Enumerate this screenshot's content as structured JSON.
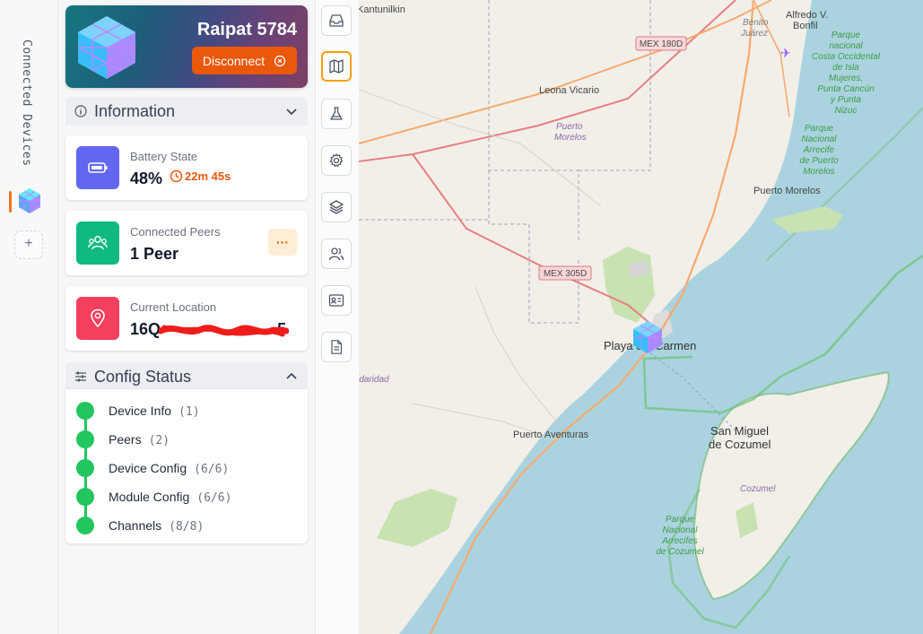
{
  "rail": {
    "title": "Connected Devices",
    "add_label": "+"
  },
  "device": {
    "name": "Raipat 5784",
    "disconnect_label": "Disconnect"
  },
  "information": {
    "title": "Information",
    "battery": {
      "label": "Battery State",
      "value": "48%",
      "time": "22m 45s"
    },
    "peers": {
      "label": "Connected Peers",
      "value": "1 Peer",
      "menu_label": "···"
    },
    "location": {
      "label": "Current Location",
      "value_prefix": "16Q",
      "value_suffix": "5"
    }
  },
  "config": {
    "title": "Config Status",
    "items": [
      {
        "name": "Device Info",
        "count": "(1)"
      },
      {
        "name": "Peers",
        "count": "(2)"
      },
      {
        "name": "Device Config",
        "count": "(6/6)"
      },
      {
        "name": "Module Config",
        "count": "(6/6)"
      },
      {
        "name": "Channels",
        "count": "(8/8)"
      }
    ]
  },
  "tools": [
    "inbox-icon",
    "map-icon",
    "flask-icon",
    "settings-icon",
    "layers-icon",
    "users-icon",
    "id-card-icon",
    "document-icon"
  ],
  "map": {
    "labels": {
      "kantunilkin": "Kantunilkin",
      "alfredo1": "Alfredo V.",
      "alfredo2": "Bonfil",
      "benito1": "Benito",
      "benito2": "Juárez",
      "mex180": "MEX 180D",
      "mex305": "MEX 305D",
      "leona": "Leona Vicario",
      "pmorelos1": "Puerto",
      "pmorelos2": "Morelos",
      "puerto_morelos": "Puerto Morelos",
      "playa": "Playa del Carmen",
      "aventuras": "Puerto Aventuras",
      "solidaridad": "idaridad",
      "sanmiguel1": "San Miguel",
      "sanmiguel2": "de Cozumel",
      "cozumel": "Cozumel",
      "park1": [
        "Parque",
        "nacional",
        "Costa Occidental",
        "de Isla",
        "Mujeres,",
        "Punta Cancún",
        "y Punta",
        "Nizuc"
      ],
      "park2": [
        "Parque",
        "Nacional",
        "Arrecife",
        "de Puerto",
        "Morelos"
      ],
      "park3": [
        "Parque",
        "Nacional",
        "Arrecifes",
        "de Cozumel"
      ]
    }
  },
  "colors": {
    "accent": "#ea580c",
    "success": "#22c55e",
    "battery": "#6366f1",
    "peers": "#10b981",
    "location": "#f43f5e"
  }
}
